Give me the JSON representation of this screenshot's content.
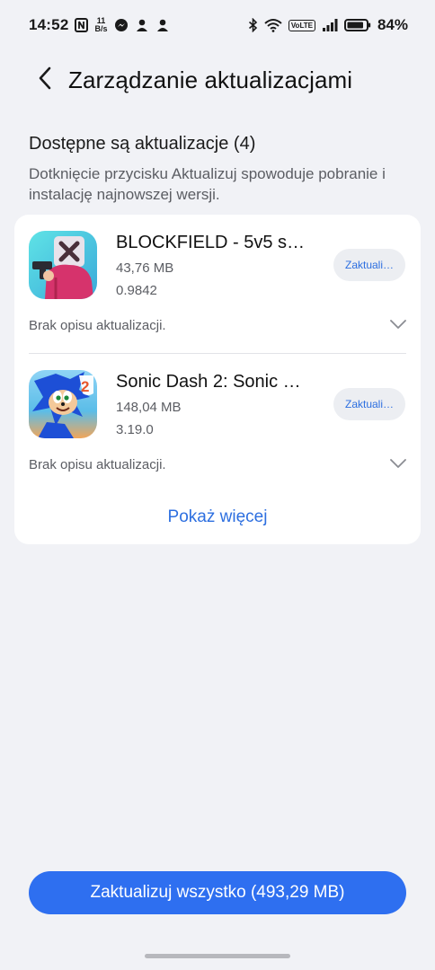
{
  "status_bar": {
    "time": "14:52",
    "net_speed_value": "11",
    "net_speed_unit": "B/s",
    "volte": "VoLTE",
    "battery_percent": "84%"
  },
  "header": {
    "title": "Zarządzanie aktualizacjami"
  },
  "section": {
    "title": "Dostępne są aktualizacje (4)",
    "description": "Dotknięcie przycisku Aktualizuj spowoduje pobranie i instalację najnowszej wersji."
  },
  "apps": [
    {
      "name": "BLOCKFIELD - 5v5 s…",
      "size": "43,76 MB",
      "version": "0.9842",
      "update_label": "Zaktuali…",
      "description": "Brak opisu aktualizacji.",
      "icon": "blockfield-app-icon"
    },
    {
      "name": "Sonic Dash 2: Sonic …",
      "size": "148,04 MB",
      "version": "3.19.0",
      "update_label": "Zaktuali…",
      "description": "Brak opisu aktualizacji.",
      "icon": "sonic-dash-2-app-icon"
    }
  ],
  "show_more_label": "Pokaż więcej",
  "update_all_label": "Zaktualizuj wszystko (493,29 MB)",
  "colors": {
    "accent": "#2e6ff0",
    "link": "#2d6fe0",
    "background": "#f1f2f6"
  }
}
